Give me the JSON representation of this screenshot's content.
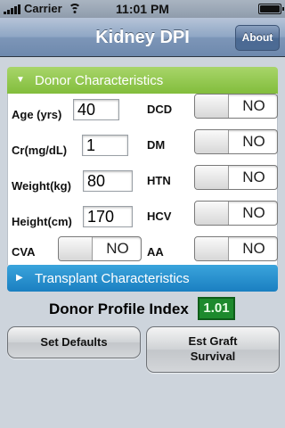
{
  "status_bar": {
    "carrier": "Carrier",
    "time": "11:01 PM",
    "icons": [
      "signal-bars-icon",
      "wifi-icon",
      "battery-icon"
    ]
  },
  "nav": {
    "title": "Kidney DPI",
    "about_label": "About"
  },
  "donor": {
    "header": "Donor Characteristics",
    "age": {
      "label": "Age (yrs)",
      "value": "40"
    },
    "cr": {
      "label": "Cr(mg/dL)",
      "value": "1"
    },
    "weight": {
      "label": "Weight(kg)",
      "value": "80"
    },
    "height": {
      "label": "Height(cm)",
      "value": "170"
    },
    "cva": {
      "label": "CVA",
      "value": "NO"
    },
    "dcd": {
      "label": "DCD",
      "value": "NO"
    },
    "dm": {
      "label": "DM",
      "value": "NO"
    },
    "htn": {
      "label": "HTN",
      "value": "NO"
    },
    "hcv": {
      "label": "HCV",
      "value": "NO"
    },
    "aa": {
      "label": "AA",
      "value": "NO"
    }
  },
  "transplant": {
    "header": "Transplant Characteristics"
  },
  "result": {
    "label": "Donor Profile Index",
    "value": "1.01"
  },
  "buttons": {
    "defaults": "Set Defaults",
    "graft_line1": "Est Graft",
    "graft_line2": "Survival"
  },
  "colors": {
    "green_header": "#82bd3c",
    "blue_header": "#1a7fc1",
    "dpi_box": "#1d8a2d"
  }
}
